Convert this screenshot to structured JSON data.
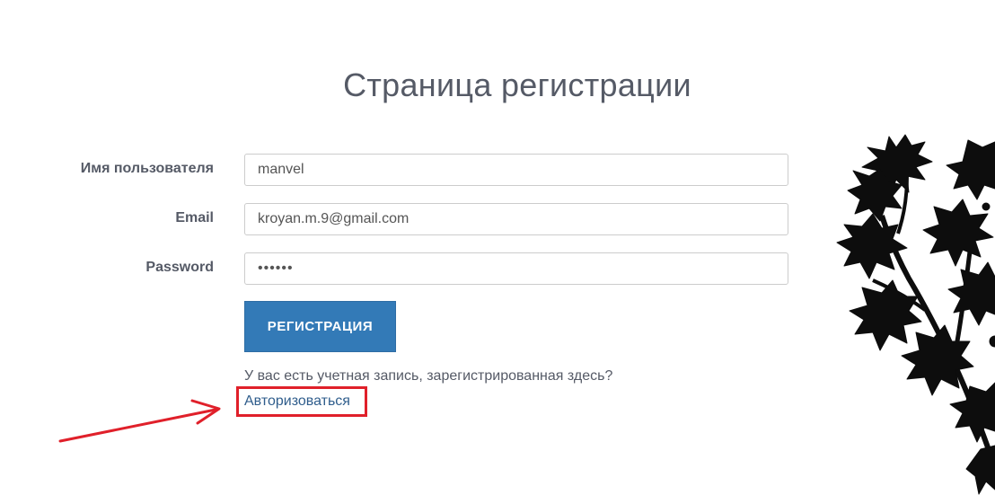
{
  "page_title": "Страница регистрации",
  "form": {
    "username_label": "Имя пользователя",
    "username_value": "manvel",
    "email_label": "Email",
    "email_value": "kroyan.m.9@gmail.com",
    "password_label": "Password",
    "password_value": "••••••",
    "submit_label": "РЕГИСТРАЦИЯ"
  },
  "footer": {
    "prompt": "У вас есть учетная запись, зарегистрированная здесь?",
    "login_link": "Авторизоваться"
  },
  "annotation": {
    "highlight_color": "#e0202a"
  },
  "decoration": {
    "icon": "tree-branch-silhouette"
  }
}
